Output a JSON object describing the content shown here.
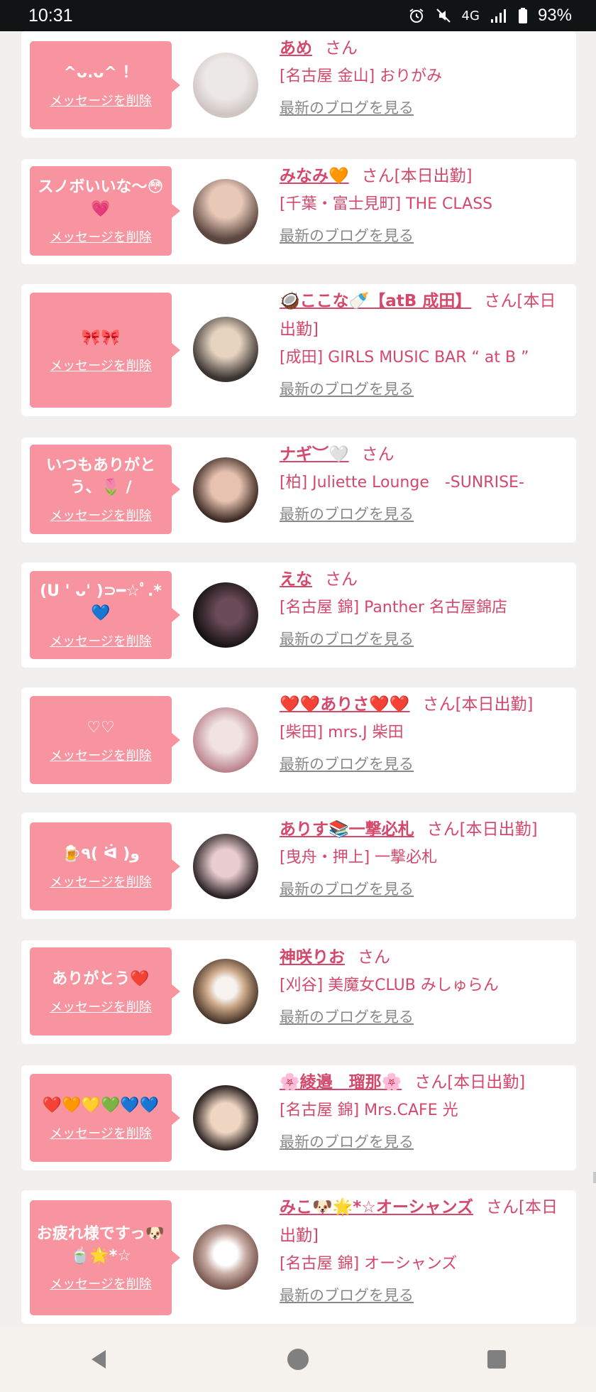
{
  "status": {
    "time": "10:31",
    "network": "4G",
    "battery": "93%",
    "icons": [
      "alarm-icon",
      "mute-icon",
      "signal-icon",
      "battery-icon"
    ]
  },
  "accent": "#f7949f",
  "link_color": "#d3486b",
  "cards": [
    {
      "message": "^ᴗ.ᴗ^ ！",
      "delete_label": "メッセージを削除",
      "name": "あめ",
      "suffix": "さん",
      "shop": "[名古屋 金山] おりがみ",
      "blog": "最新のブログを見る"
    },
    {
      "message": "スノボいいな〜😳💗",
      "delete_label": "メッセージを削除",
      "name": "みなみ🧡",
      "suffix": "さん[本日出勤]",
      "shop": "[千葉・富士見町] THE CLASS",
      "blog": "最新のブログを見る"
    },
    {
      "message": "🎀🎀",
      "delete_label": "メッセージを削除",
      "name": "🥥ここな🍼【atB 成田】",
      "suffix": "さん[本日出勤]",
      "shop": "[成田] GIRLS MUSIC BAR “ at B ”",
      "blog": "最新のブログを見る"
    },
    {
      "message": "いつもありがとう、🌷 /",
      "delete_label": "メッセージを削除",
      "name": "ナギ︶🤍",
      "suffix": "さん",
      "shop": "[柏] Juliette Lounge　-SUNRISE-",
      "blog": "最新のブログを見る"
    },
    {
      "message": "(U ' ᴗ' )⊃━☆ﾟ.*💙",
      "delete_label": "メッセージを削除",
      "name": "えな",
      "suffix": "さん",
      "shop": "[名古屋 錦] Panther 名古屋錦店",
      "blog": "最新のブログを見る"
    },
    {
      "message": "♡♡",
      "delete_label": "メッセージを削除",
      "name": "❤️❤️ありさ❤️❤️",
      "suffix": "さん[本日出勤]",
      "shop": "[柴田] mrs.J 柴田",
      "blog": "最新のブログを見る"
    },
    {
      "message": "🍺٩( ᐛ )و",
      "delete_label": "メッセージを削除",
      "name": "ありす📚一撃必札",
      "suffix": "さん[本日出勤]",
      "shop": "[曳舟・押上] 一撃必札",
      "blog": "最新のブログを見る"
    },
    {
      "message": "ありがとう❤️",
      "delete_label": "メッセージを削除",
      "name": "神咲りお",
      "suffix": "さん",
      "shop": "[刈谷] 美魔女CLUB みしゅらん",
      "blog": "最新のブログを見る"
    },
    {
      "message": "❤️🧡💛💚💙💙",
      "delete_label": "メッセージを削除",
      "name": "🌸綾邉　瑠那🌸",
      "suffix": "さん[本日出勤]",
      "shop": "[名古屋 錦] Mrs.CAFE 光",
      "blog": "最新のブログを見る"
    },
    {
      "message": "お疲れ様ですっ🐶🍵🌟*☆",
      "delete_label": "メッセージを削除",
      "name": "みこ🐶🌟*☆オーシャンズ",
      "suffix": "さん[本日出勤]",
      "shop": "[名古屋 錦] オーシャンズ",
      "blog": "最新のブログを見る"
    }
  ]
}
